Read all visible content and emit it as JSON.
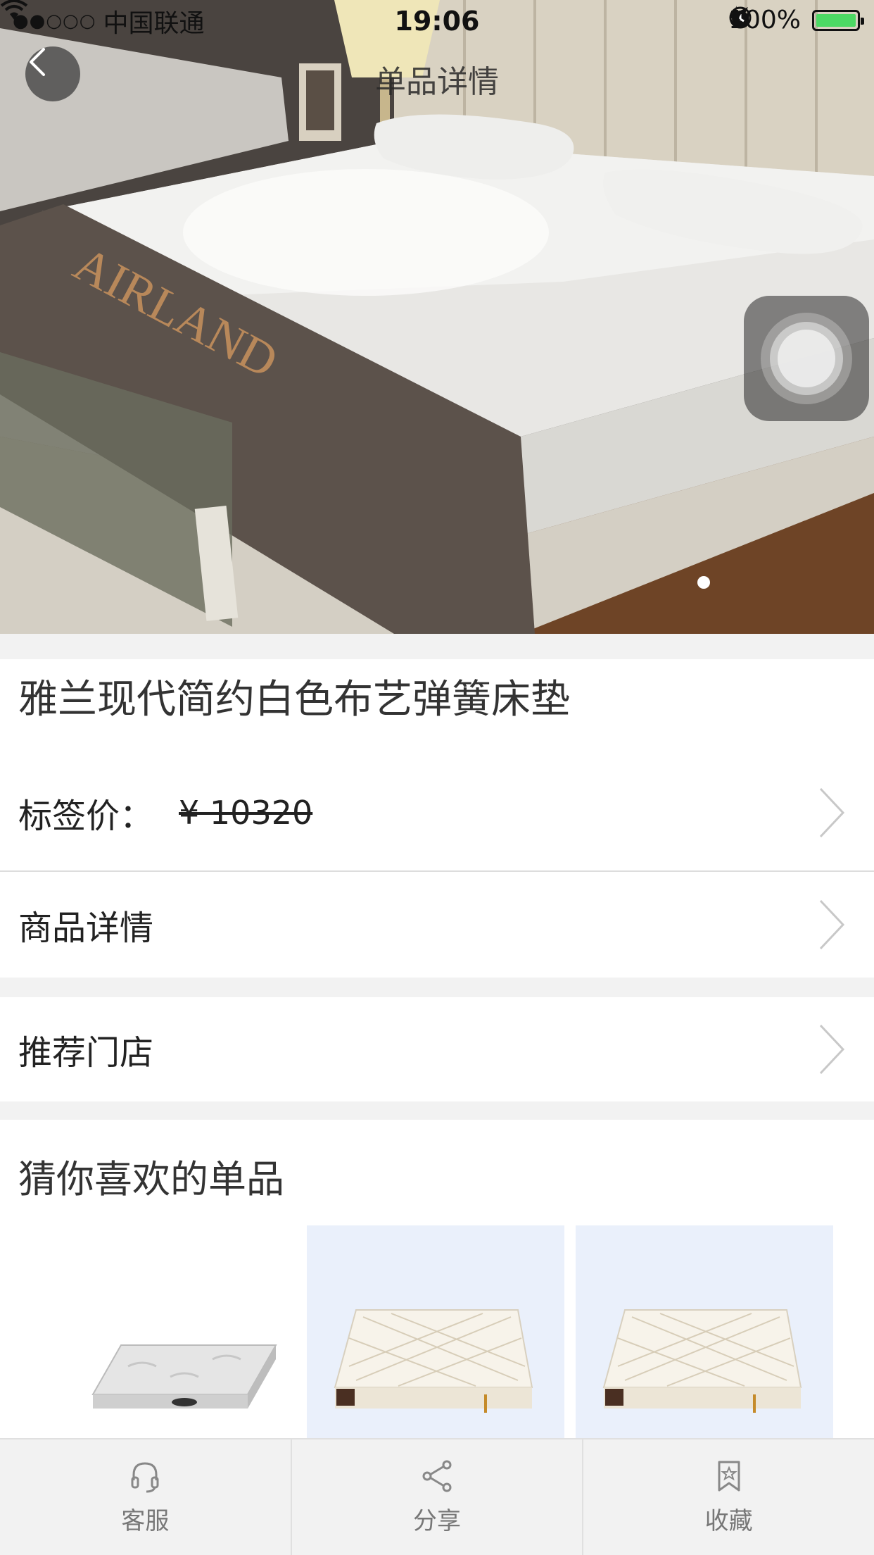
{
  "status_bar": {
    "carrier": "中国联通",
    "time": "19:06",
    "battery_text": "100%",
    "battery_level": 1.0
  },
  "nav": {
    "title": "单品详情",
    "back_icon": "chevron-left-icon"
  },
  "hero": {
    "brand_print": "AIRLAND",
    "page_index": 1,
    "page_count": 1
  },
  "product": {
    "name": "雅兰现代简约白色布艺弹簧床垫",
    "price_label": "标签价：",
    "price_value": "¥ 10320"
  },
  "menu": {
    "details_label": "商品详情",
    "stores_label": "推荐门店"
  },
  "recommend": {
    "title": "猜你喜欢的单品",
    "items": [
      {
        "name": "mattress-gray-thumbnail",
        "bg": "#ffffff"
      },
      {
        "name": "mattress-cream-thumbnail",
        "bg": "#eaf0fb"
      },
      {
        "name": "mattress-cream-thumbnail-2",
        "bg": "#eaf0fb"
      }
    ]
  },
  "tabbar": {
    "items": [
      {
        "label": "客服",
        "icon": "headset-icon"
      },
      {
        "label": "分享",
        "icon": "share-icon"
      },
      {
        "label": "收藏",
        "icon": "bookmark-star-icon"
      }
    ]
  },
  "colors": {
    "battery_green": "#4cd964",
    "text_primary": "#222222",
    "tab_label": "#777777",
    "page_bg": "#f2f2f2"
  }
}
